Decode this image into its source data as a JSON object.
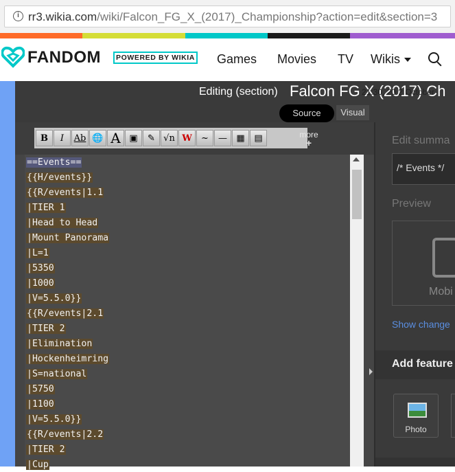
{
  "browser": {
    "url_host": "rr3.wikia.com",
    "url_rest": "/wiki/Falcon_FG_X_(2017)_Championship?action=edit&section=3"
  },
  "colors": {
    "stripe": [
      "#fe6a28",
      "#d4dd36",
      "#00c8c8",
      "#1a1a1a",
      "#9f5ccf"
    ],
    "brand_teal": "#00c8c8",
    "left_rail": "#6fa2f5"
  },
  "nav": {
    "logo_text": "FANDOM",
    "powered": "POWERED BY WIKIA",
    "links": [
      "Games",
      "Movies",
      "TV",
      "Wikis"
    ],
    "wikis_dropdown_icon": "caret-down-icon",
    "search_icon": "search-icon"
  },
  "header": {
    "editing_label": "Editing (section)",
    "title": "Falcon FG X (2017) Ch",
    "timestamp": "21:30, 20 2 October",
    "tab_source": "Source",
    "tab_visual": "Visual"
  },
  "toolbar": {
    "buttons": [
      "B",
      "I",
      "Ab",
      "🌐",
      "A",
      "▣",
      "✎",
      "√n",
      "W",
      "~",
      "—",
      "▦",
      "▤"
    ],
    "icons": [
      "bold-icon",
      "italic-icon",
      "internal-link-icon",
      "external-link-icon",
      "headline-icon",
      "embedded-file-icon",
      "media-link-icon",
      "math-formula-icon",
      "nowiki-icon",
      "signature-icon",
      "horizontal-line-icon",
      "gallery-icon",
      "slideshow-icon"
    ],
    "more": "more"
  },
  "editor": {
    "lines": [
      "==Events==",
      "{{H/events}}",
      "{{R/events|1.1",
      "|TIER 1",
      "|Head to Head",
      "|Mount Panorama",
      "|L=1",
      "|5350",
      "|1000",
      "|V=5.5.0}}",
      "{{R/events|2.1",
      "|TIER 2",
      "|Elimination",
      "|Hockenheimring",
      "|S=national",
      "|5750",
      "|1100",
      "|V=5.5.0}}",
      "{{R/events|2.2",
      "|TIER 2",
      "|Cup"
    ]
  },
  "rail": {
    "summary_label": "Edit summa",
    "summary_value": "/* Events */",
    "preview_label": "Preview",
    "mobile_label": "Mobi",
    "show_changes": "Show change",
    "add_features": "Add feature",
    "photo_label": "Photo"
  }
}
